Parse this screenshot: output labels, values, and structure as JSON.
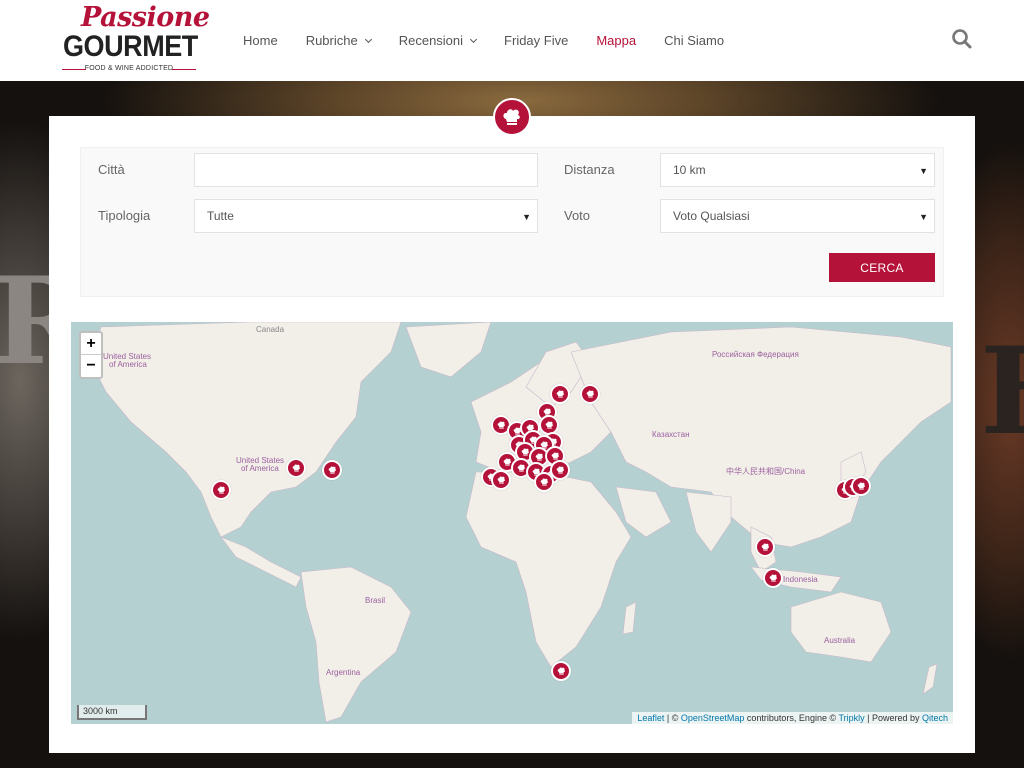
{
  "brand": {
    "script": "Passione",
    "main": "GOURMET",
    "tagline": "FOOD & WINE ADDICTED"
  },
  "nav": {
    "items": [
      {
        "label": "Home",
        "dropdown": false
      },
      {
        "label": "Rubriche",
        "dropdown": true
      },
      {
        "label": "Recensioni",
        "dropdown": true
      },
      {
        "label": "Friday Five",
        "dropdown": false
      },
      {
        "label": "Mappa",
        "dropdown": false,
        "active": true
      },
      {
        "label": "Chi Siamo",
        "dropdown": false
      }
    ],
    "search_icon": "search-icon"
  },
  "filters": {
    "citta_label": "Città",
    "citta_value": "",
    "distanza_label": "Distanza",
    "distanza_value": "10 km",
    "tipologia_label": "Tipologia",
    "tipologia_value": "Tutte",
    "voto_label": "Voto",
    "voto_value": "Voto Qualsiasi",
    "submit_label": "CERCA"
  },
  "map": {
    "zoom_in": "+",
    "zoom_out": "−",
    "labels": {
      "canada": "Canada",
      "usa_top_1": "United States",
      "usa_top_2": "of America",
      "usa_mid_1": "United States",
      "usa_mid_2": "of America",
      "russia": "Российская Федерация",
      "kazakhstan": "Казахстан",
      "china": "中华人民共和国/China",
      "brasil": "Brasil",
      "argentina": "Argentina",
      "indonesia": "Indonesia",
      "australia": "Australia"
    },
    "scale": "3000 km",
    "attribution": {
      "leaflet": "Leaflet",
      "sep1": " | © ",
      "osm": "OpenStreetMap",
      "mid": " contributors, Engine © ",
      "tripkly": "Tripkly",
      "sep2": " | Powered by ",
      "qitech": "Qitech"
    }
  },
  "colors": {
    "accent": "#b5123a",
    "sea": "#b5d0d0",
    "land": "#f2efe9"
  }
}
